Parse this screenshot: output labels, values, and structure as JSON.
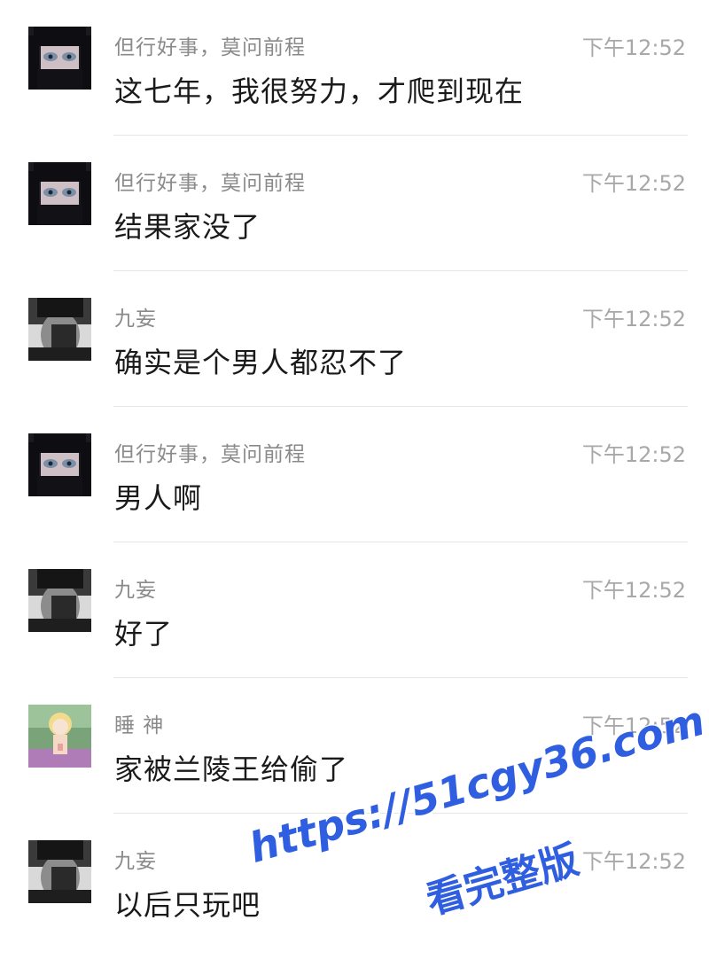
{
  "messages": [
    {
      "avatar": "avatar-dark-haired-girl",
      "name": "但行好事，莫问前程",
      "time": "下午12:52",
      "text": "这七年，我很努力，才爬到现在"
    },
    {
      "avatar": "avatar-dark-haired-girl",
      "name": "但行好事，莫问前程",
      "time": "下午12:52",
      "text": "结果家没了"
    },
    {
      "avatar": "avatar-man-hand-on-face",
      "name": "九妄",
      "time": "下午12:52",
      "text": "确实是个男人都忍不了"
    },
    {
      "avatar": "avatar-dark-haired-girl",
      "name": "但行好事，莫问前程",
      "time": "下午12:52",
      "text": "男人啊"
    },
    {
      "avatar": "avatar-man-hand-on-face",
      "name": "九妄",
      "time": "下午12:52",
      "text": "好了"
    },
    {
      "avatar": "avatar-anime-blonde-child",
      "name": "睡 神",
      "time": "下午12:52",
      "text": "家被兰陵王给偷了"
    },
    {
      "avatar": "avatar-man-hand-on-face",
      "name": "九妄",
      "time": "下午12:52",
      "text": "以后只玩吧"
    }
  ],
  "watermark": {
    "url": "https://51cgy36.com",
    "caption": "看完整版",
    "color": "#2f5ee0"
  }
}
